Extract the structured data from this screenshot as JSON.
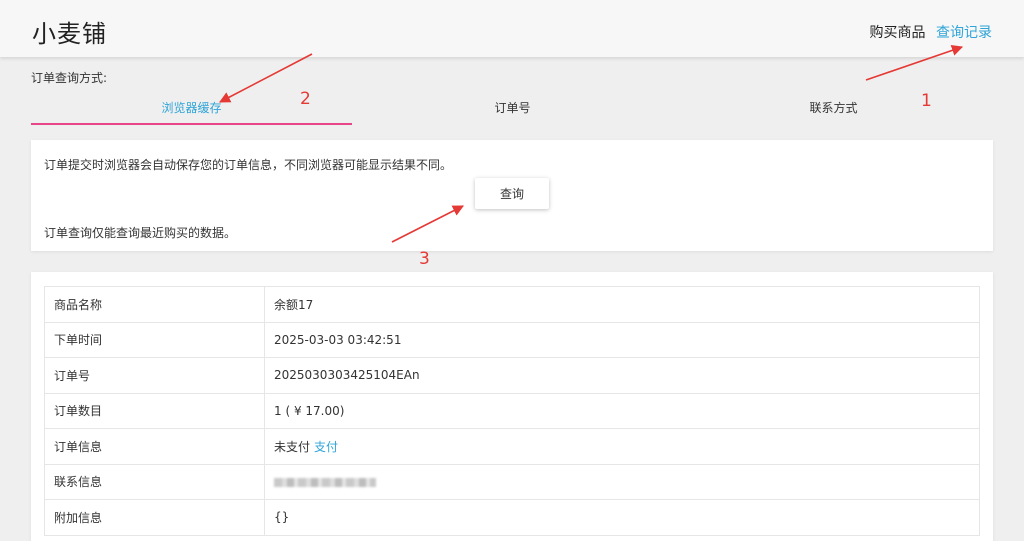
{
  "header": {
    "brand": "小麦铺",
    "nav": {
      "buy_label": "购买商品",
      "query_label": "查询记录"
    }
  },
  "query_method": {
    "label": "订单查询方式:",
    "tabs": [
      {
        "label": "浏览器缓存",
        "active": true
      },
      {
        "label": "订单号",
        "active": false
      },
      {
        "label": "联系方式",
        "active": false
      }
    ]
  },
  "cache_panel": {
    "info_line1": "订单提交时浏览器会自动保存您的订单信息，不同浏览器可能显示结果不同。",
    "query_button": "查询",
    "info_line2": "订单查询仅能查询最近购买的数据。"
  },
  "order": {
    "rows": [
      {
        "key": "商品名称",
        "value": "余额17"
      },
      {
        "key": "下单时间",
        "value": "2025-03-03 03:42:51"
      },
      {
        "key": "订单号",
        "value": "2025030303425104EAn"
      },
      {
        "key": "订单数目",
        "value": "1 ( ¥ 17.00)"
      },
      {
        "key": "订单信息",
        "value": "未支付",
        "link": "支付"
      },
      {
        "key": "联系信息",
        "value": ""
      },
      {
        "key": "附加信息",
        "value": "{}"
      }
    ]
  },
  "annotations": {
    "n1": "1",
    "n2": "2",
    "n3": "3"
  },
  "colors": {
    "accent_blue": "#2fa4d8",
    "tab_underline": "#e8468b",
    "annotation_red": "#e53935"
  }
}
